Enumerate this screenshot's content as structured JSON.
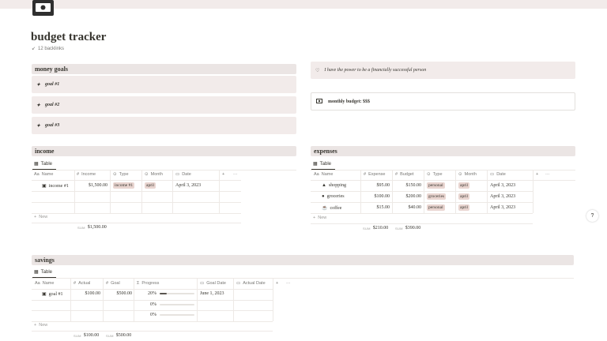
{
  "page": {
    "title": "budget tracker",
    "backlinks": "12 backlinks",
    "help": "?"
  },
  "goals": {
    "header": "money goals",
    "items": [
      "goal #1",
      "goal #2",
      "goal #3"
    ]
  },
  "callout": {
    "text": "I have the power to be a financially successful person"
  },
  "budget": {
    "text": "monthly budget: $$$"
  },
  "income": {
    "header": "income",
    "tab": "Table",
    "columns": [
      "Name",
      "Income",
      "Type",
      "Month",
      "Date"
    ],
    "rows": [
      {
        "name": "income #1",
        "income": "$1,500.00",
        "type": "income #1",
        "month": "april",
        "date": "April 3, 2023"
      }
    ],
    "new_label": "New",
    "sum_label": "SUM",
    "sum_value": "$1,500.00"
  },
  "expenses": {
    "header": "expenses",
    "tab": "Table",
    "columns": [
      "Name",
      "Expense",
      "Budget",
      "Type",
      "Month",
      "Date"
    ],
    "rows": [
      {
        "name": "shopping",
        "expense": "$95.00",
        "budget": "$150.00",
        "type": "personal",
        "month": "april",
        "date": "April 3, 2023"
      },
      {
        "name": "groceries",
        "expense": "$100.00",
        "budget": "$200.00",
        "type": "groceries",
        "month": "april",
        "date": "April 3, 2023"
      },
      {
        "name": "coffee",
        "expense": "$15.00",
        "budget": "$40.00",
        "type": "personal",
        "month": "april",
        "date": "April 3, 2023"
      }
    ],
    "new_label": "New",
    "sum_label": "SUM",
    "sum_expense": "$210.00",
    "sum_budget": "$390.00"
  },
  "savings": {
    "header": "savings",
    "tab": "Table",
    "columns": [
      "Name",
      "Actual",
      "Goal",
      "Progress",
      "Goal Date",
      "Actual Date"
    ],
    "rows": [
      {
        "name": "goal #1",
        "actual": "$100.00",
        "goal": "$500.00",
        "progress": "20%",
        "progress_value": 0.2,
        "goal_date": "June 1, 2023",
        "actual_date": ""
      },
      {
        "name": "",
        "actual": "",
        "goal": "",
        "progress": "0%",
        "progress_value": 0,
        "goal_date": "",
        "actual_date": ""
      },
      {
        "name": "",
        "actual": "",
        "goal": "",
        "progress": "0%",
        "progress_value": 0,
        "goal_date": "",
        "actual_date": ""
      }
    ],
    "new_label": "New",
    "sum_label": "SUM",
    "sum_actual": "$100.00",
    "sum_goal": "$500.00"
  },
  "colors": {
    "tag_bg": "#e9d5d0",
    "section_bg": "#ebe5e4",
    "block_bg": "#f2ebea"
  }
}
